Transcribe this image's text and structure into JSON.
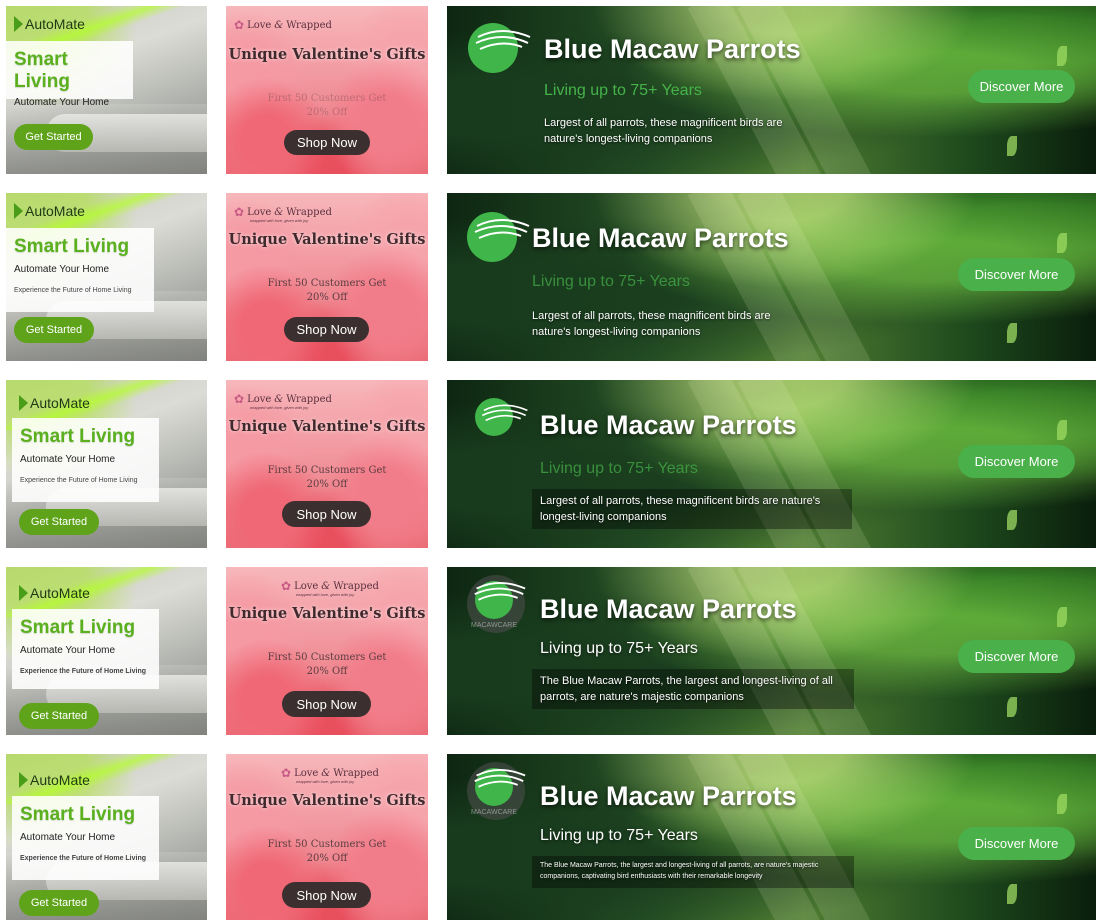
{
  "colors": {
    "automate_green": "#5fa31a",
    "valentine_button": "#3c2f2f",
    "macaw_button": "#4ab04a",
    "macaw_green": "#46b34a"
  },
  "icons": {
    "automate_logo": "chevron-right-icon",
    "valentine_logo": "heart-icon",
    "macaw_logo": "parrot-wing-icon"
  },
  "rows": [
    {
      "automate": {
        "brand": "AutoMate",
        "title": "Smart Living",
        "subtitle": "Automate Your Home",
        "tagline": "",
        "button": "Get Started"
      },
      "valentine": {
        "logo_left": "Love",
        "logo_amp": "&",
        "logo_right": "Wrapped",
        "logo_sub": "",
        "title": "Unique Valentine's Gifts",
        "offer": "First 50 Customers Get 20% Off",
        "button": "Shop Now"
      },
      "macaw": {
        "title": "Blue Macaw Parrots",
        "subtitle": "Living up to 75+ Years",
        "description": "Largest of all parrots, these magnificent birds are nature's longest-living companions",
        "button": "Discover More",
        "watermark": ""
      }
    },
    {
      "automate": {
        "brand": "AutoMate",
        "title": "Smart Living",
        "subtitle": "Automate Your Home",
        "tagline": "Experience the Future of Home Living",
        "button": "Get Started"
      },
      "valentine": {
        "logo_left": "Love",
        "logo_amp": "&",
        "logo_right": "Wrapped",
        "logo_sub": "wrapped with love, given with joy",
        "title": "Unique Valentine's Gifts",
        "offer": "First 50 Customers Get 20% Off",
        "button": "Shop Now"
      },
      "macaw": {
        "title": "Blue Macaw Parrots",
        "subtitle": "Living up to 75+ Years",
        "description": "Largest of all parrots, these magnificent birds are nature's longest-living companions",
        "button": "Discover More",
        "watermark": ""
      }
    },
    {
      "automate": {
        "brand": "AutoMate",
        "title": "Smart Living",
        "subtitle": "Automate Your Home",
        "tagline": "Experience the Future of Home Living",
        "button": "Get Started"
      },
      "valentine": {
        "logo_left": "Love",
        "logo_amp": "&",
        "logo_right": "Wrapped",
        "logo_sub": "wrapped with love, given with joy",
        "title": "Unique Valentine's Gifts",
        "offer": "First 50 Customers Get 20% Off",
        "button": "Shop Now"
      },
      "macaw": {
        "title": "Blue Macaw Parrots",
        "subtitle": "Living up to 75+ Years",
        "description": "Largest of all parrots, these magnificent birds are nature's longest-living companions",
        "button": "Discover More",
        "watermark": ""
      }
    },
    {
      "automate": {
        "brand": "AutoMate",
        "title": "Smart Living",
        "subtitle": "Automate Your Home",
        "tagline": "Experience the Future of Home Living",
        "button": "Get Started"
      },
      "valentine": {
        "logo_left": "Love",
        "logo_amp": "&",
        "logo_right": "Wrapped",
        "logo_sub": "wrapped with love, given with joy",
        "title": "Unique Valentine's Gifts",
        "offer": "First 50 Customers Get 20% Off",
        "button": "Shop Now"
      },
      "macaw": {
        "title": "Blue Macaw Parrots",
        "subtitle": "Living up to 75+ Years",
        "description": "The Blue Macaw Parrots, the largest and longest-living of all parrots, are nature's majestic companions",
        "button": "Discover More",
        "watermark": "MACAWCARE"
      }
    },
    {
      "automate": {
        "brand": "AutoMate",
        "title": "Smart Living",
        "subtitle": "Automate Your Home",
        "tagline": "Experience the Future of Home Living",
        "button": "Get Started"
      },
      "valentine": {
        "logo_left": "Love",
        "logo_amp": "&",
        "logo_right": "Wrapped",
        "logo_sub": "wrapped with love, given with joy",
        "title": "Unique Valentine's Gifts",
        "offer": "First 50 Customers Get 20% Off",
        "button": "Shop Now"
      },
      "macaw": {
        "title": "Blue Macaw Parrots",
        "subtitle": "Living up to 75+ Years",
        "description": "The Blue Macaw Parrots, the largest and longest-living of all parrots, are nature's majestic companions, captivating bird enthusiasts with their remarkable longevity",
        "button": "Discover More",
        "watermark": "MACAWCARE"
      }
    }
  ]
}
